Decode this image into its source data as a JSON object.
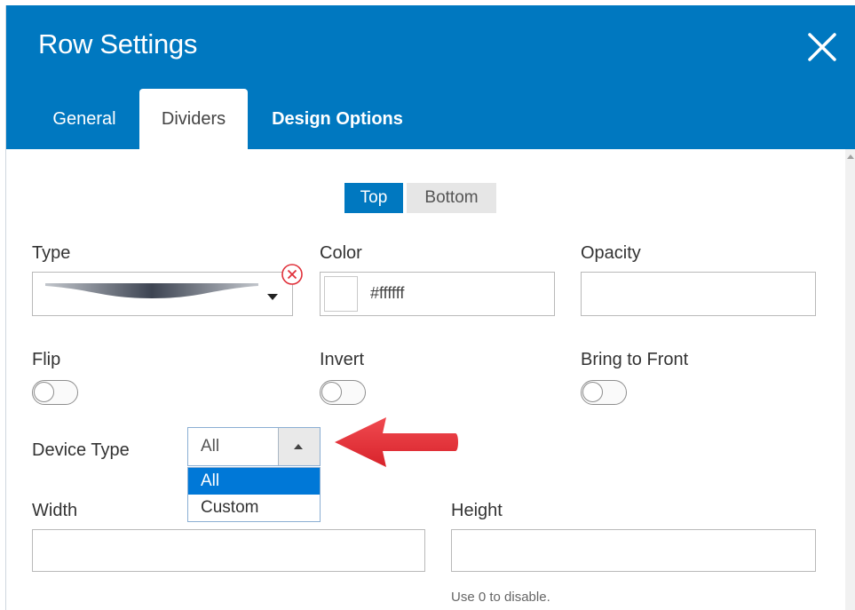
{
  "dialog": {
    "title": "Row Settings",
    "close_icon": "close-x-icon"
  },
  "tabs": [
    {
      "label": "General",
      "active": false
    },
    {
      "label": "Dividers",
      "active": true
    },
    {
      "label": "Design Options",
      "active": false
    }
  ],
  "position_toggle": {
    "top_label": "Top",
    "bottom_label": "Bottom",
    "selected": "Top"
  },
  "fields": {
    "type": {
      "label": "Type",
      "clear_icon": "clear-circle-x-icon",
      "dropdown_icon": "caret-down-icon"
    },
    "color": {
      "label": "Color",
      "value": "#ffffff"
    },
    "opacity": {
      "label": "Opacity",
      "value": ""
    },
    "flip": {
      "label": "Flip",
      "on": false
    },
    "invert": {
      "label": "Invert",
      "on": false
    },
    "bring_to_front": {
      "label": "Bring to Front",
      "on": false
    },
    "device_type": {
      "label": "Device Type",
      "value": "All",
      "options": [
        "All",
        "Custom"
      ],
      "highlighted": "All"
    },
    "width": {
      "label": "Width",
      "value": ""
    },
    "height": {
      "label": "Height",
      "value": "",
      "help": "Use 0 to disable."
    }
  },
  "colors": {
    "header_bg": "#0078c0",
    "accent": "#0078c0",
    "annotation_arrow": "#e8313a"
  }
}
